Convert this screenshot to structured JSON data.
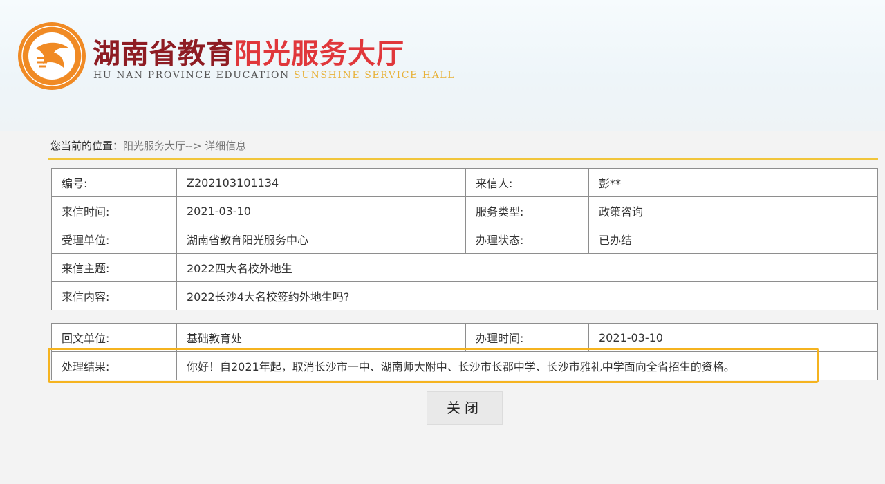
{
  "header": {
    "title_part1": "湖南省教育",
    "title_part2": "阳光服务大厅",
    "subtitle_part1": "HU NAN PROVINCE EDUCATION ",
    "subtitle_part2": "SUNSHINE SERVICE HALL",
    "logo_icon": "dove-sun-logo-icon",
    "colors": {
      "title_dark": "#8e1c23",
      "title_red": "#e0373b",
      "logo_orange": "#f08a24",
      "accent_yellow": "#f1c53a"
    }
  },
  "breadcrumb": {
    "label": "您当前的位置：",
    "path": "阳光服务大厅--> 详细信息"
  },
  "details": {
    "number_label": "编号:",
    "number_value": "Z202103101134",
    "sender_label": "来信人:",
    "sender_value": "彭**",
    "time_label": "来信时间:",
    "time_value": "2021-03-10",
    "service_type_label": "服务类型:",
    "service_type_value": "政策咨询",
    "handling_unit_label": "受理单位:",
    "handling_unit_value": "湖南省教育阳光服务中心",
    "status_label": "办理状态:",
    "status_value": "已办结",
    "subject_label": "来信主题:",
    "subject_value": "2022四大名校外地生",
    "content_label": "来信内容:",
    "content_value": "2022长沙4大名校签约外地生吗?"
  },
  "reply": {
    "unit_label": "回文单位:",
    "unit_value": "基础教育处",
    "time_label": "办理时间:",
    "time_value": "2021-03-10",
    "result_label": "处理结果:",
    "result_value": "你好！自2021年起，取消长沙市一中、湖南师大附中、长沙市长郡中学、长沙市雅礼中学面向全省招生的资格。"
  },
  "actions": {
    "close_label": "关闭"
  },
  "highlight_color": "#f5b31f"
}
